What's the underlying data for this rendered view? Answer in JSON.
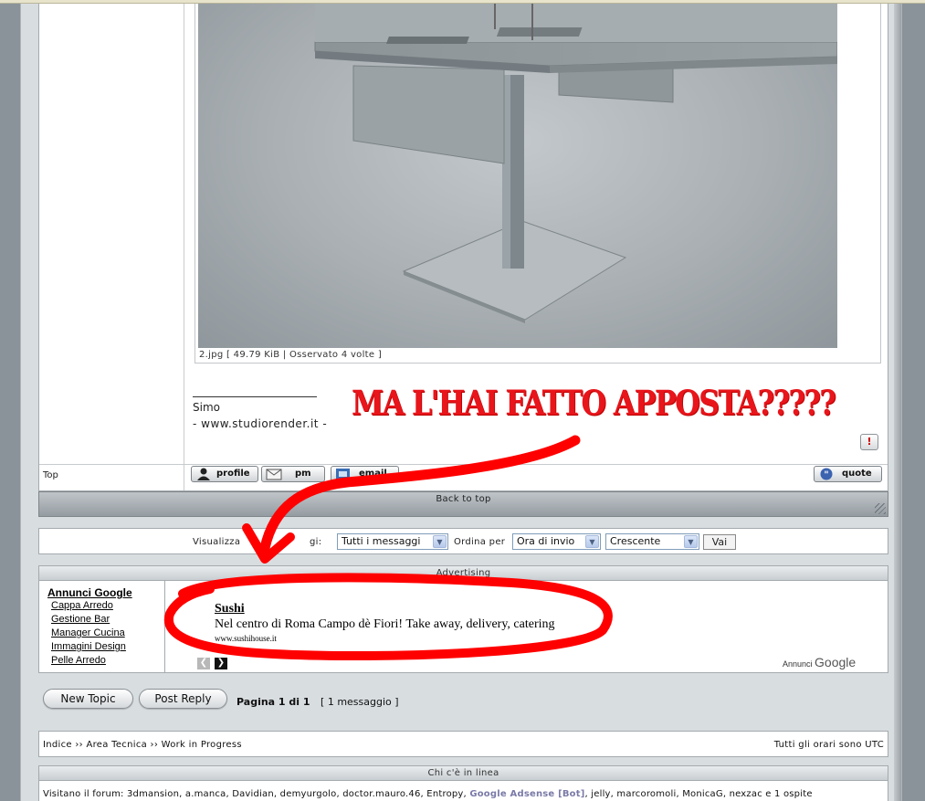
{
  "attachment": {
    "caption": "2.jpg [ 49.79 KiB | Osservato 4 volte ]"
  },
  "signature": {
    "name": "Simo",
    "site": "- www.studiorender.it -"
  },
  "post": {
    "top_link": "Top",
    "report_label": "!",
    "buttons": {
      "profile": "profile",
      "pm": "pm",
      "email": "email",
      "quote": "quote"
    }
  },
  "back_to_top": "Back to top",
  "sort": {
    "display_label": "Visualizza",
    "display_label_tail": "gi:",
    "display_value": "Tutti i messaggi",
    "order_label": "Ordina per",
    "order_value": "Ora di invio",
    "direction_value": "Crescente",
    "go_label": "Vai"
  },
  "advertising": {
    "header": "Advertising",
    "links_title": "Annunci Google",
    "links": [
      "Cappa Arredo",
      "Gestione Bar",
      "Manager Cucina",
      "Immagini Design",
      "Pelle Arredo"
    ],
    "ad_title": "Sushi",
    "ad_text": "Nel centro di Roma Campo dè Fiori! Take away, delivery, catering",
    "ad_url": "www.sushihouse.it",
    "brand_prefix": "Annunci",
    "brand_name": "Google"
  },
  "actions": {
    "new_topic": "New Topic",
    "post_reply": "Post Reply",
    "page_info": "Pagina 1 di 1",
    "message_count": "[ 1 messaggio ]"
  },
  "breadcrumb": {
    "items": [
      "Indice",
      "Area Tecnica",
      "Work in Progress"
    ],
    "separator": "››",
    "timezone": "Tutti gli orari sono UTC"
  },
  "online": {
    "header": "Chi c'è in linea",
    "prefix": "Visitano il forum: 3dmansion, a.manca, Davidian, demyurgolo, doctor.mauro.46, Entropy,",
    "bot": "Google Adsense [Bot]",
    "suffix": ", jelly, marcoromoli, MonicaG, nexzac e 1 ospite"
  },
  "annotation": {
    "text": "MA L'HAI FATTO APPOSTA?????",
    "color": "#e8151b"
  },
  "colors": {
    "page_bg": "#d8dde0",
    "outer_bg": "#8a9399",
    "annotation_red": "#ff0000"
  }
}
